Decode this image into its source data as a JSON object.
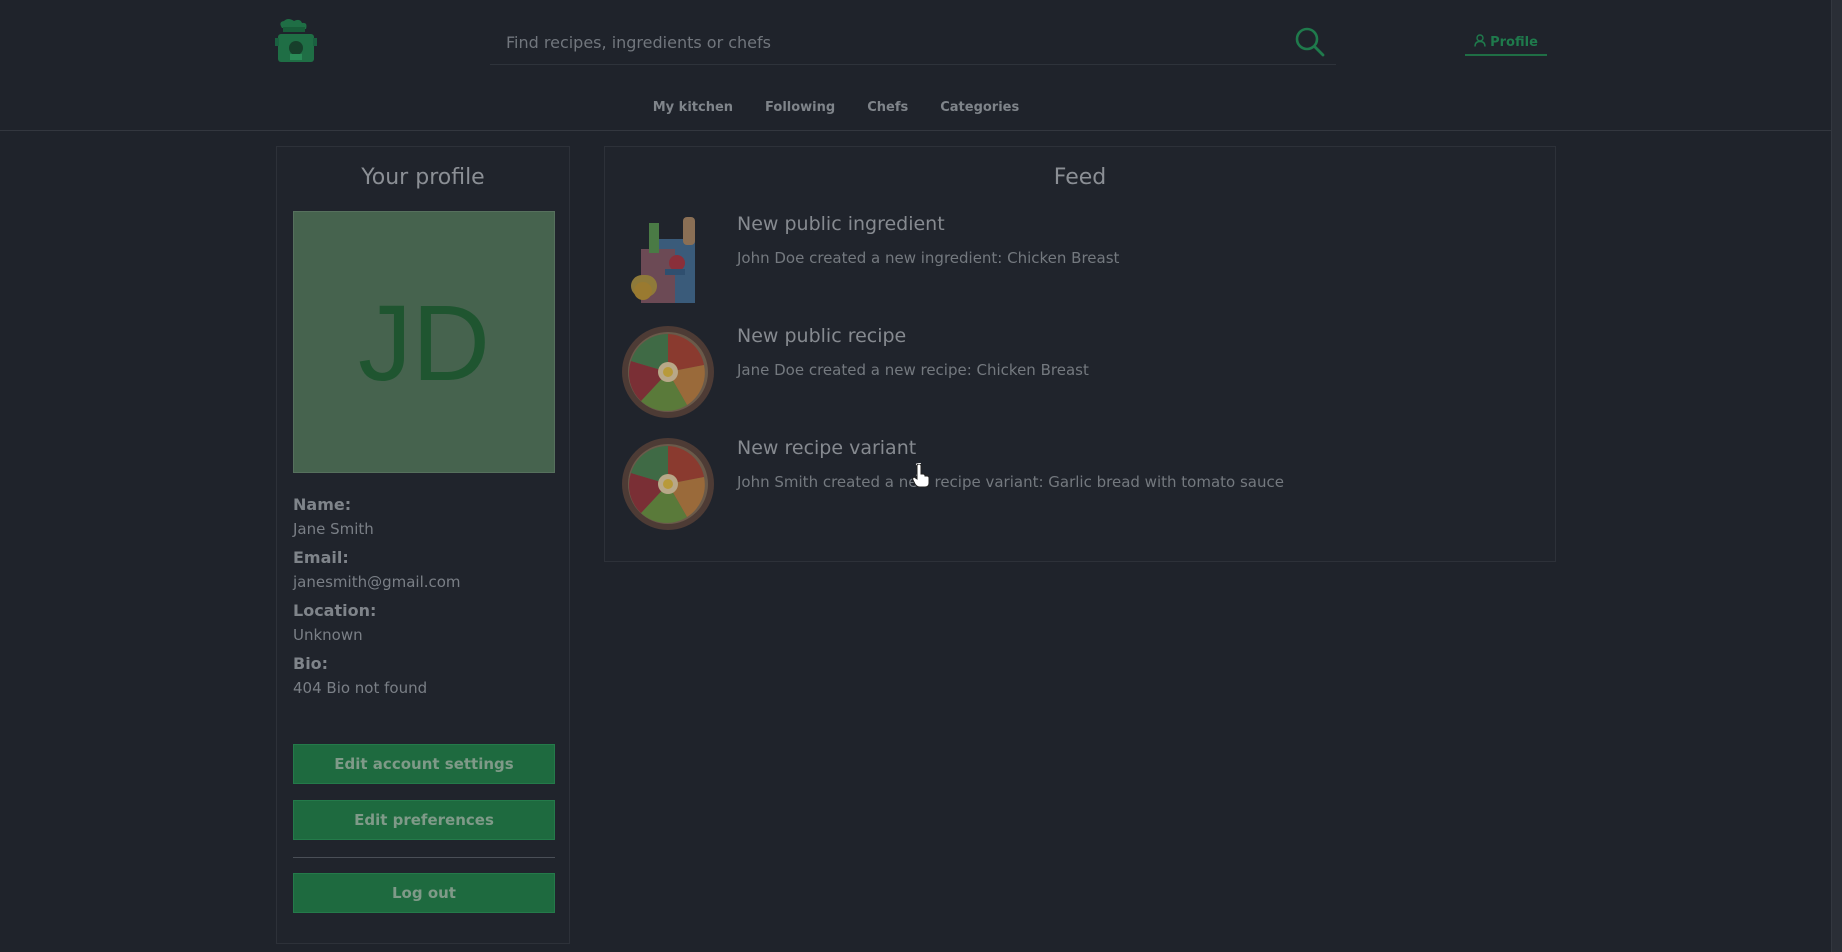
{
  "header": {
    "logo_icon": "chef-hat-pot-icon",
    "search_placeholder": "Find recipes, ingredients or chefs",
    "search_value": "",
    "profile_label": "Profile",
    "accent_color": "#1f7a4c"
  },
  "nav": {
    "items": [
      "My kitchen",
      "Following",
      "Chefs",
      "Categories"
    ]
  },
  "profile": {
    "heading": "Your profile",
    "avatar_initials": "JD",
    "name_label": "Name:",
    "name_value": "Jane Smith",
    "email_label": "Email:",
    "email_value": "janesmith@gmail.com",
    "location_label": "Location:",
    "location_value": "Unknown",
    "bio_label": "Bio:",
    "bio_value": "404 Bio not found",
    "edit_account_label": "Edit account settings",
    "edit_prefs_label": "Edit preferences",
    "logout_label": "Log out"
  },
  "feed": {
    "heading": "Feed",
    "items": [
      {
        "icon": "grocery-bag-icon",
        "title": "New public ingredient",
        "desc": "John Doe created a new ingredient: Chicken Breast"
      },
      {
        "icon": "food-bowl-icon",
        "title": "New public recipe",
        "desc": "Jane Doe created a new recipe: Chicken Breast"
      },
      {
        "icon": "food-bowl-icon",
        "title": "New recipe variant",
        "desc": "John Smith created a new recipe variant: Garlic bread with tomato sauce"
      }
    ]
  },
  "cursor": {
    "badge": "1"
  }
}
